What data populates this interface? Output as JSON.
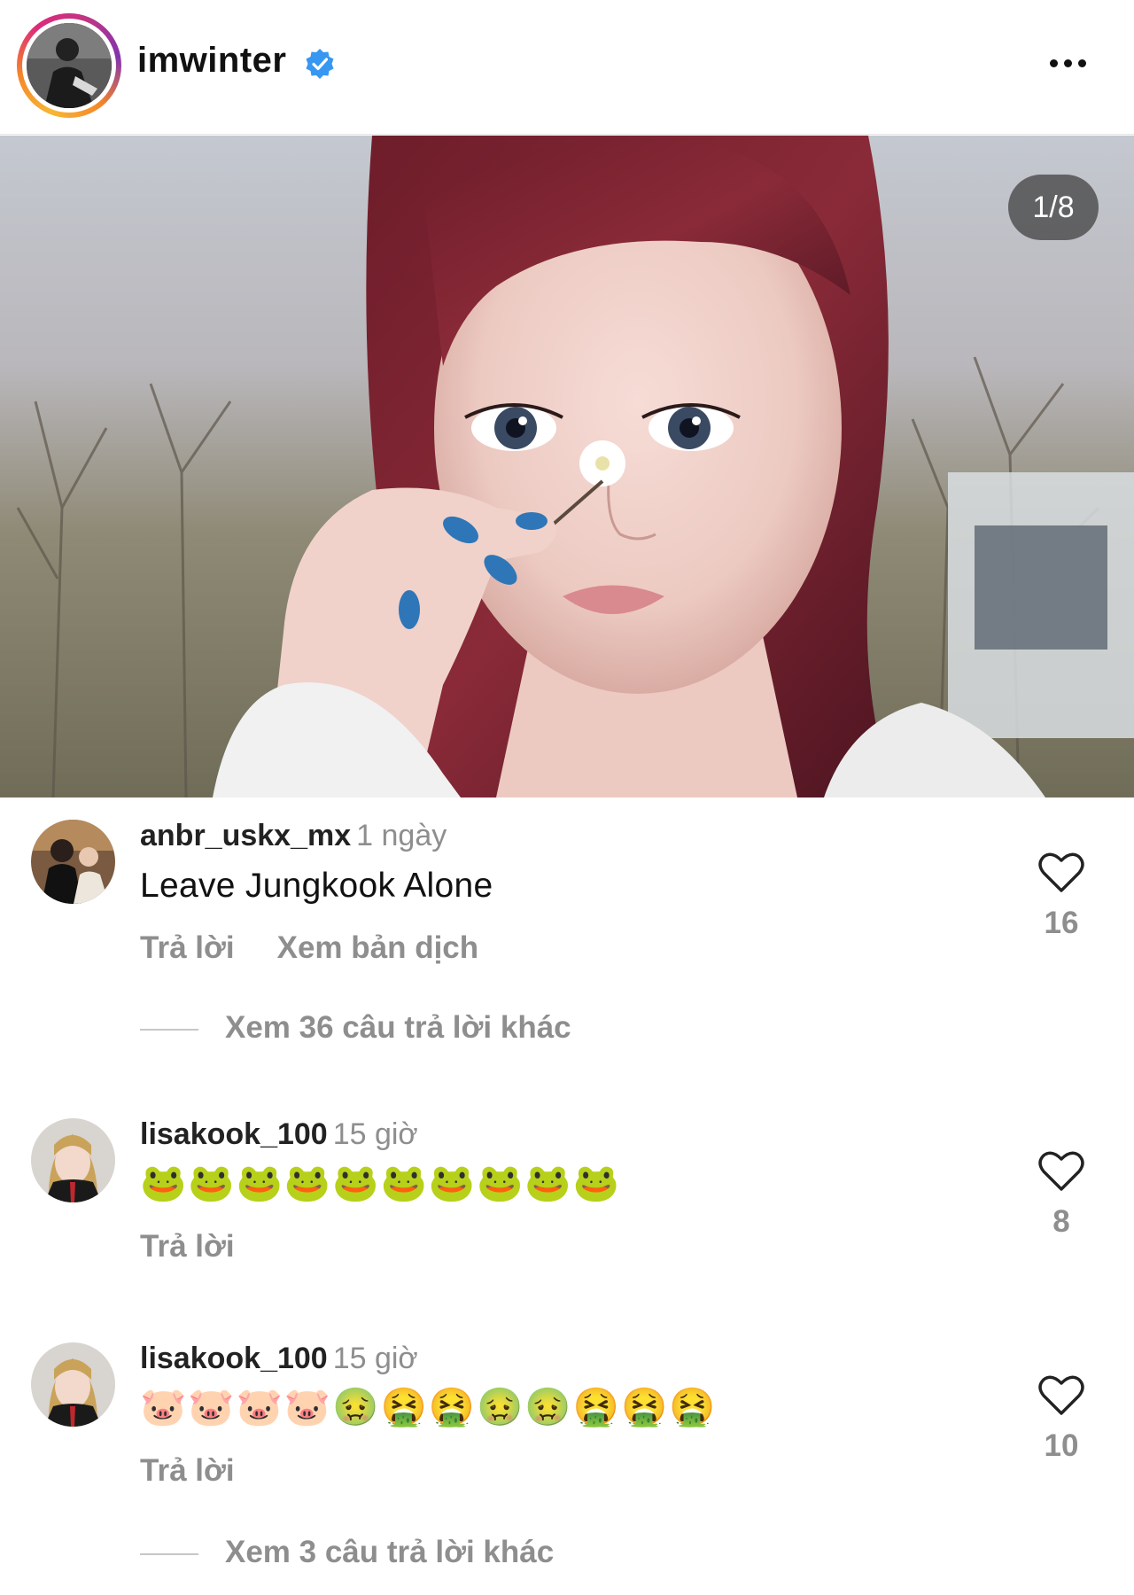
{
  "header": {
    "username": "imwinter",
    "verified_icon": "verified-badge-icon",
    "more_icon": "more-horizontal-icon"
  },
  "post": {
    "image_counter": "1/8"
  },
  "comments": [
    {
      "username": "anbr_uskx_mx",
      "time": "1 ngày",
      "text": "Leave Jungkook Alone",
      "actions": {
        "reply": "Trả lời",
        "translate": "Xem bản dịch"
      },
      "likes": "16",
      "view_replies": "Xem 36 câu trả lời khác"
    },
    {
      "username": "lisakook_100",
      "time": "15 giờ",
      "text": "🐸🐸🐸🐸🐸🐸🐸🐸🐸🐸",
      "actions": {
        "reply": "Trả lời"
      },
      "likes": "8"
    },
    {
      "username": "lisakook_100",
      "time": "15 giờ",
      "text": "🐷🐷🐷🐷🤢🤮🤮🤢🤢🤮🤮🤮",
      "actions": {
        "reply": "Trả lời"
      },
      "likes": "10",
      "view_replies": "Xem 3 câu trả lời khác"
    }
  ],
  "colors": {
    "text_primary": "#111111",
    "text_secondary": "#8e8e8e",
    "verified_blue": "#3897f0",
    "counter_bg": "#4a4a4a"
  }
}
